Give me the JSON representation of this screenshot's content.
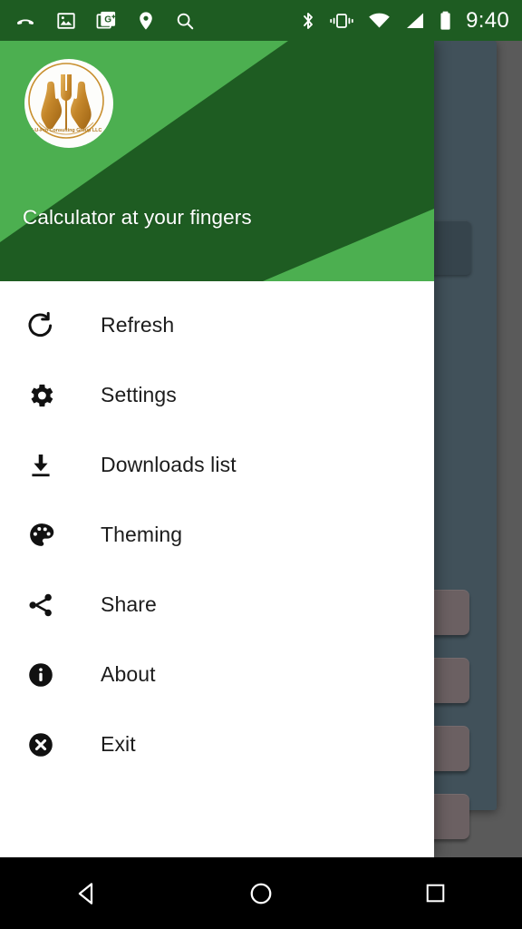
{
  "status_bar": {
    "background": "#1e5c22",
    "clock": "9:40",
    "left_icons": [
      {
        "name": "call-ended-icon",
        "label": "missed call"
      },
      {
        "name": "image-icon",
        "label": "screenshot"
      },
      {
        "name": "google-photos-icon",
        "label": "google photos"
      },
      {
        "name": "location-pin-icon",
        "label": "location"
      },
      {
        "name": "search-icon",
        "label": "search"
      }
    ],
    "right_icons": [
      {
        "name": "bluetooth-icon",
        "label": "bluetooth"
      },
      {
        "name": "vibrate-icon",
        "label": "vibrate"
      },
      {
        "name": "wifi-icon",
        "label": "wifi"
      },
      {
        "name": "cell-signal-icon",
        "label": "signal"
      },
      {
        "name": "battery-icon",
        "label": "battery"
      }
    ]
  },
  "drawer": {
    "header": {
      "subtitle": "Calculator at your fingers",
      "colors": {
        "light_green": "#4caf50",
        "dark_green": "#1e5c22",
        "bright_green": "#06c755"
      },
      "logo": {
        "name": "4u-pro-consulting-group-logo",
        "caption": "4-U-Pro Consulting Group LLC",
        "gold": "#c88f2e"
      }
    },
    "menu": [
      {
        "icon": "refresh-icon",
        "label": "Refresh"
      },
      {
        "icon": "gear-icon",
        "label": "Settings"
      },
      {
        "icon": "download-icon",
        "label": "Downloads list"
      },
      {
        "icon": "palette-icon",
        "label": "Theming"
      },
      {
        "icon": "share-icon",
        "label": "Share"
      },
      {
        "icon": "info-icon",
        "label": "About"
      },
      {
        "icon": "close-circle-icon",
        "label": "Exit"
      }
    ]
  },
  "background_app": {
    "panel_color": "#41515a",
    "display_color": "#36444c",
    "key_color": "#6b6062",
    "keys_visible": 4
  },
  "nav_bar": {
    "background": "#000000",
    "buttons": [
      {
        "name": "back-button",
        "label": "Back"
      },
      {
        "name": "home-button",
        "label": "Home"
      },
      {
        "name": "recents-button",
        "label": "Recents"
      }
    ]
  }
}
